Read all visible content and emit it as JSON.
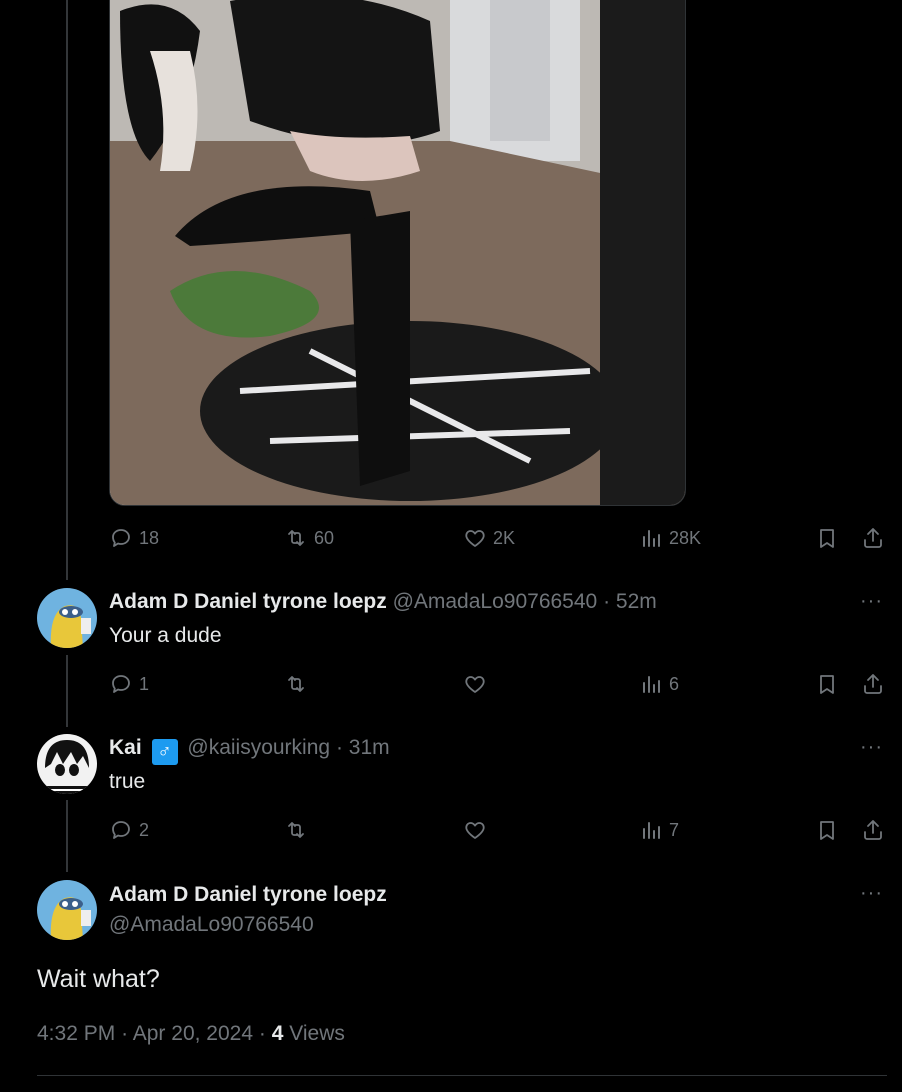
{
  "original_post": {
    "image_alt": "",
    "actions": {
      "replies": "18",
      "reposts": "60",
      "likes": "2K",
      "views": "28K"
    }
  },
  "replies": [
    {
      "name": "Adam D Daniel tyrone loepz",
      "handle": "@AmadaLo90766540",
      "sep": "·",
      "time": "52m",
      "text": "Your a dude",
      "actions": {
        "replies": "1",
        "reposts": "",
        "likes": "",
        "views": "6"
      }
    },
    {
      "name": "Kai",
      "badge": "♂",
      "handle": "@kaiisyourking",
      "sep": "·",
      "time": "31m",
      "text": "true",
      "actions": {
        "replies": "2",
        "reposts": "",
        "likes": "",
        "views": "7"
      }
    }
  ],
  "main_tweet": {
    "name": "Adam D Daniel tyrone loepz",
    "handle": "@AmadaLo90766540",
    "text": "Wait what?",
    "time": "4:32 PM",
    "date": "Apr 20, 2024",
    "sep": "·",
    "views_count": "4",
    "views_label": "Views",
    "more": "···"
  },
  "icons": {
    "reply": "reply-icon",
    "repost": "repost-icon",
    "like": "heart-icon",
    "views": "analytics-icon",
    "bookmark": "bookmark-icon",
    "share": "share-icon",
    "more": "more-icon"
  },
  "colors": {
    "background": "#000000",
    "text": "#e7e9ea",
    "muted": "#71767b",
    "badge": "#1d9bf0",
    "line": "#333639"
  }
}
